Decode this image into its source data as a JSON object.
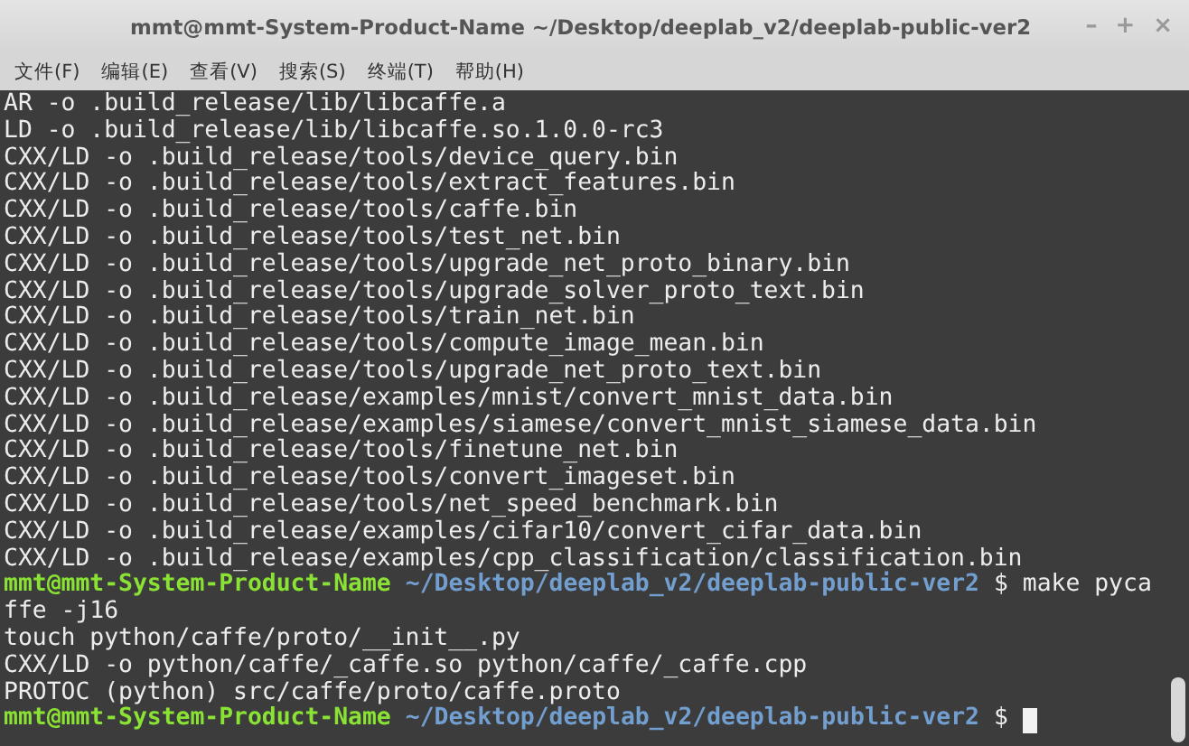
{
  "window": {
    "title": "mmt@mmt-System-Product-Name ~/Desktop/deeplab_v2/deeplab-public-ver2",
    "controls": [
      "–",
      "+",
      "×"
    ]
  },
  "menu": [
    {
      "label": "文件(F)"
    },
    {
      "label": "编辑(E)"
    },
    {
      "label": "查看(V)"
    },
    {
      "label": "搜索(S)"
    },
    {
      "label": "终端(T)"
    },
    {
      "label": "帮助(H)"
    }
  ],
  "terminal": {
    "lines": [
      {
        "kind": "output",
        "text": "AR -o .build_release/lib/libcaffe.a"
      },
      {
        "kind": "output",
        "text": "LD -o .build_release/lib/libcaffe.so.1.0.0-rc3"
      },
      {
        "kind": "output",
        "text": "CXX/LD -o .build_release/tools/device_query.bin"
      },
      {
        "kind": "output",
        "text": "CXX/LD -o .build_release/tools/extract_features.bin"
      },
      {
        "kind": "output",
        "text": "CXX/LD -o .build_release/tools/caffe.bin"
      },
      {
        "kind": "output",
        "text": "CXX/LD -o .build_release/tools/test_net.bin"
      },
      {
        "kind": "output",
        "text": "CXX/LD -o .build_release/tools/upgrade_net_proto_binary.bin"
      },
      {
        "kind": "output",
        "text": "CXX/LD -o .build_release/tools/upgrade_solver_proto_text.bin"
      },
      {
        "kind": "output",
        "text": "CXX/LD -o .build_release/tools/train_net.bin"
      },
      {
        "kind": "output",
        "text": "CXX/LD -o .build_release/tools/compute_image_mean.bin"
      },
      {
        "kind": "output",
        "text": "CXX/LD -o .build_release/tools/upgrade_net_proto_text.bin"
      },
      {
        "kind": "output",
        "text": "CXX/LD -o .build_release/examples/mnist/convert_mnist_data.bin"
      },
      {
        "kind": "output",
        "text": "CXX/LD -o .build_release/examples/siamese/convert_mnist_siamese_data.bin"
      },
      {
        "kind": "output",
        "text": "CXX/LD -o .build_release/tools/finetune_net.bin"
      },
      {
        "kind": "output",
        "text": "CXX/LD -o .build_release/tools/convert_imageset.bin"
      },
      {
        "kind": "output",
        "text": "CXX/LD -o .build_release/tools/net_speed_benchmark.bin"
      },
      {
        "kind": "output",
        "text": "CXX/LD -o .build_release/examples/cifar10/convert_cifar_data.bin"
      },
      {
        "kind": "output",
        "text": "CXX/LD -o .build_release/examples/cpp_classification/classification.bin"
      },
      {
        "kind": "prompt",
        "user": "mmt@mmt-System-Product-Name",
        "path": "~/Desktop/deeplab_v2/deeplab-public-ver2",
        "symbol": "$",
        "command": "make pyca"
      },
      {
        "kind": "output",
        "text": "ffe -j16"
      },
      {
        "kind": "output",
        "text": "touch python/caffe/proto/__init__.py"
      },
      {
        "kind": "output",
        "text": "CXX/LD -o python/caffe/_caffe.so python/caffe/_caffe.cpp"
      },
      {
        "kind": "output",
        "text": "PROTOC (python) src/caffe/proto/caffe.proto"
      },
      {
        "kind": "prompt",
        "user": "mmt@mmt-System-Product-Name",
        "path": "~/Desktop/deeplab_v2/deeplab-public-ver2",
        "symbol": "$",
        "cursor": true
      }
    ]
  }
}
